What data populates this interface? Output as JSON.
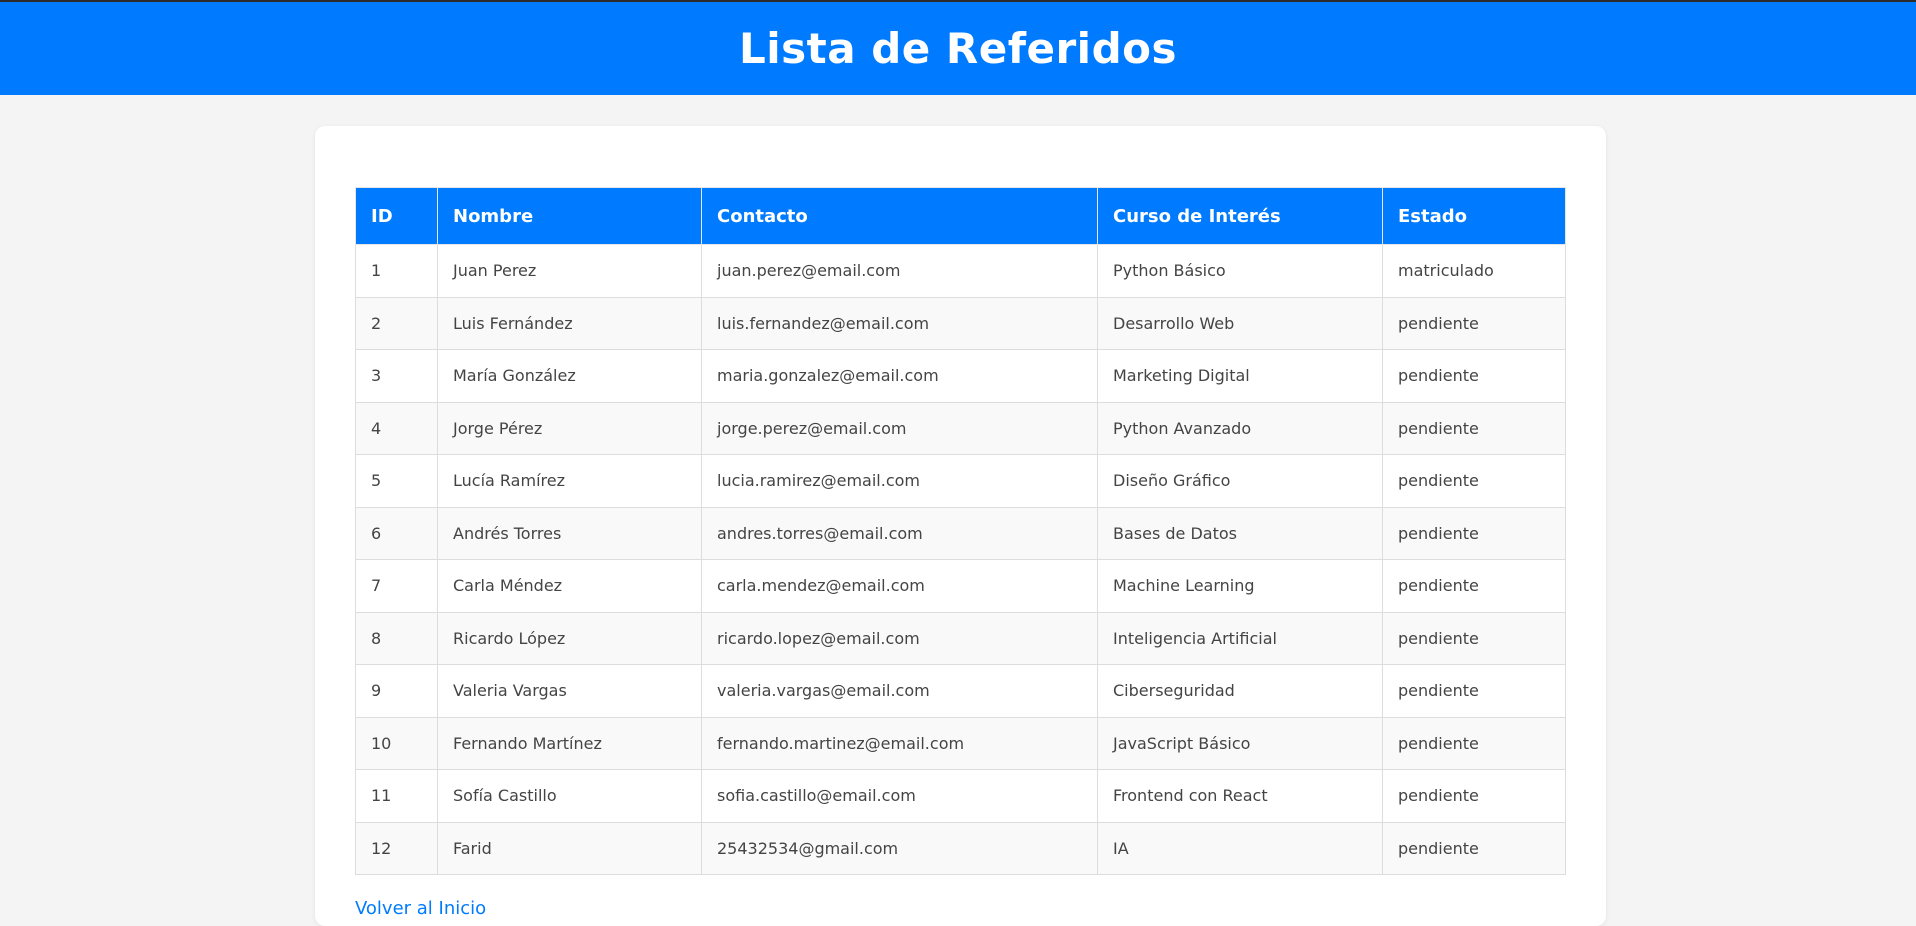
{
  "header": {
    "title": "Lista de Referidos"
  },
  "table": {
    "columns": [
      "ID",
      "Nombre",
      "Contacto",
      "Curso de Interés",
      "Estado"
    ],
    "rows": [
      {
        "id": "1",
        "nombre": "Juan Perez",
        "contacto": "juan.perez@email.com",
        "curso": "Python Básico",
        "estado": "matriculado"
      },
      {
        "id": "2",
        "nombre": "Luis Fernández",
        "contacto": "luis.fernandez@email.com",
        "curso": "Desarrollo Web",
        "estado": "pendiente"
      },
      {
        "id": "3",
        "nombre": "María González",
        "contacto": "maria.gonzalez@email.com",
        "curso": "Marketing Digital",
        "estado": "pendiente"
      },
      {
        "id": "4",
        "nombre": "Jorge Pérez",
        "contacto": "jorge.perez@email.com",
        "curso": "Python Avanzado",
        "estado": "pendiente"
      },
      {
        "id": "5",
        "nombre": "Lucía Ramírez",
        "contacto": "lucia.ramirez@email.com",
        "curso": "Diseño Gráfico",
        "estado": "pendiente"
      },
      {
        "id": "6",
        "nombre": "Andrés Torres",
        "contacto": "andres.torres@email.com",
        "curso": "Bases de Datos",
        "estado": "pendiente"
      },
      {
        "id": "7",
        "nombre": "Carla Méndez",
        "contacto": "carla.mendez@email.com",
        "curso": "Machine Learning",
        "estado": "pendiente"
      },
      {
        "id": "8",
        "nombre": "Ricardo López",
        "contacto": "ricardo.lopez@email.com",
        "curso": "Inteligencia Artificial",
        "estado": "pendiente"
      },
      {
        "id": "9",
        "nombre": "Valeria Vargas",
        "contacto": "valeria.vargas@email.com",
        "curso": "Ciberseguridad",
        "estado": "pendiente"
      },
      {
        "id": "10",
        "nombre": "Fernando Martínez",
        "contacto": "fernando.martinez@email.com",
        "curso": "JavaScript Básico",
        "estado": "pendiente"
      },
      {
        "id": "11",
        "nombre": "Sofía Castillo",
        "contacto": "sofia.castillo@email.com",
        "curso": "Frontend con React",
        "estado": "pendiente"
      },
      {
        "id": "12",
        "nombre": "Farid",
        "contacto": "25432534@gmail.com",
        "curso": "IA",
        "estado": "pendiente"
      }
    ]
  },
  "footer": {
    "back_link": "Volver al Inicio"
  },
  "colors": {
    "accent": "#007bff",
    "background": "#f4f4f4",
    "card": "#ffffff"
  }
}
